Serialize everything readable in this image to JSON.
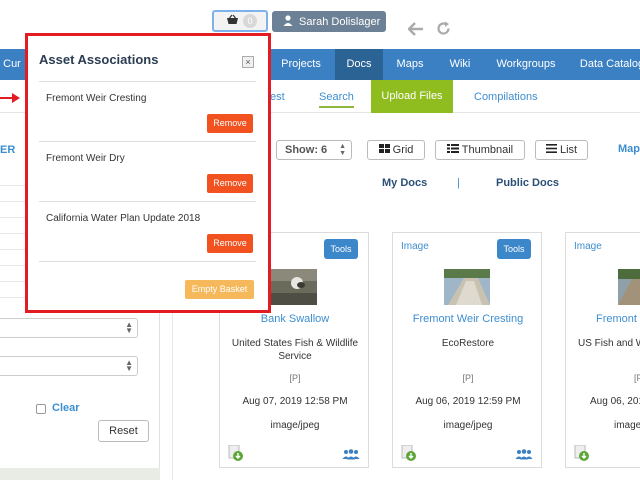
{
  "header": {
    "basket_count": "0",
    "user_name": "Sarah Dolislager"
  },
  "nav": {
    "items": [
      {
        "label": "Cur"
      },
      {
        "label": "Projects"
      },
      {
        "label": "Docs"
      },
      {
        "label": "Maps"
      },
      {
        "label": "Wiki"
      },
      {
        "label": "Workgroups"
      },
      {
        "label": "Data Catalog"
      }
    ]
  },
  "subnav": {
    "partial": "est",
    "search": "Search",
    "upload": "Upload Files",
    "compilations": "Compilations"
  },
  "sidebar": {
    "title_fragment": "ER",
    "clear_label": "Clear",
    "reset_label": "Reset"
  },
  "toolbar": {
    "show_label": "Show: 6",
    "grid_label": "Grid",
    "thumbnail_label": "Thumbnail",
    "list_label": "List",
    "map_label": "Map",
    "my_docs": "My Docs",
    "separator": "|",
    "public_docs": "Public Docs"
  },
  "cards": [
    {
      "type": "",
      "tools": "Tools",
      "title": "Bank Swallow",
      "source": "United States Fish & Wildlife Service",
      "p": "[P]",
      "date": "Aug 07, 2019 12:58 PM",
      "mime": "image/jpeg"
    },
    {
      "type": "Image",
      "tools": "Tools",
      "title": "Fremont Weir Cresting",
      "source": "EcoRestore",
      "p": "[P]",
      "date": "Aug 06, 2019 12:59 PM",
      "mime": "image/jpeg"
    },
    {
      "type": "Image",
      "tools": "",
      "title": "Fremont",
      "source": "US Fish and W",
      "p": "[P",
      "date": "Aug 06, 2019",
      "mime": "image"
    }
  ],
  "panel": {
    "title": "Asset Associations",
    "close_glyph": "×",
    "associations": [
      {
        "name": "Fremont Weir Cresting",
        "remove": "Remove"
      },
      {
        "name": "Fremont Weir Dry",
        "remove": "Remove"
      },
      {
        "name": "California Water Plan Update 2018",
        "remove": "Remove"
      }
    ],
    "empty_label": "Empty Basket"
  },
  "colors": {
    "nav_blue": "#3c80c4",
    "nav_active": "#2c6395",
    "upload_green": "#8fbc1e",
    "remove_orange": "#f1521f",
    "empty_amber": "#f5b85a",
    "panel_border_red": "#e31b23"
  },
  "icons": [
    "basket-icon",
    "user-icon",
    "back-arrow-icon",
    "refresh-icon",
    "grid-icon",
    "thumbnail-icon",
    "list-icon",
    "download-icon",
    "share-group-icon",
    "close-icon",
    "red-arrow-icon"
  ]
}
